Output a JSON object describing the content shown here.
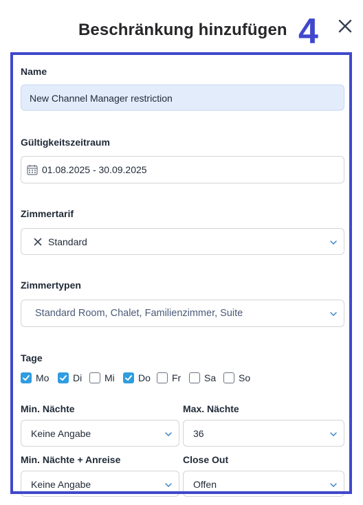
{
  "header": {
    "title": "Beschränkung hinzufügen",
    "step_number": "4"
  },
  "form": {
    "name": {
      "label": "Name",
      "value": "New Channel Manager restriction"
    },
    "validity": {
      "label": "Gültigkeitszeitraum",
      "value": "01.08.2025 - 30.09.2025"
    },
    "rate": {
      "label": "Zimmertarif",
      "value": "Standard"
    },
    "room_types": {
      "label": "Zimmertypen",
      "value": "Standard Room, Chalet, Familienzimmer, Suite"
    },
    "days": {
      "label": "Tage",
      "items": [
        {
          "label": "Mo",
          "checked": true
        },
        {
          "label": "Di",
          "checked": true
        },
        {
          "label": "Mi",
          "checked": false
        },
        {
          "label": "Do",
          "checked": true
        },
        {
          "label": "Fr",
          "checked": false
        },
        {
          "label": "Sa",
          "checked": false
        },
        {
          "label": "So",
          "checked": false
        }
      ]
    },
    "min_nights": {
      "label": "Min. Nächte",
      "value": "Keine Angabe"
    },
    "max_nights": {
      "label": "Max. Nächte",
      "value": "36"
    },
    "min_nights_arrival": {
      "label": "Min. Nächte + Anreise",
      "value": "Keine Angabe"
    },
    "close_out": {
      "label": "Close Out",
      "value": "Offen"
    }
  },
  "colors": {
    "accent": "#3f48cc",
    "checkbox": "#2f9de0",
    "input_filled": "#e3ecfb"
  },
  "icons": [
    "close-icon",
    "calendar-icon",
    "clear-icon",
    "chevron-down-icon",
    "checkmark-icon"
  ]
}
